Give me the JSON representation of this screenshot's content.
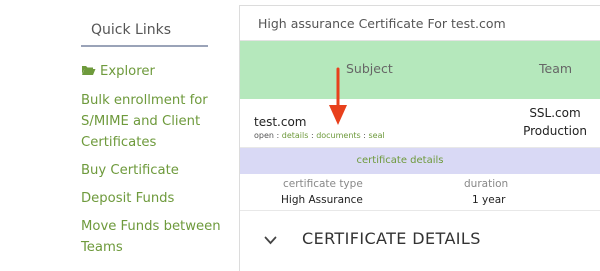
{
  "sidebar": {
    "title": "Quick Links",
    "items": [
      {
        "label": "Explorer",
        "icon": "folder-open-icon"
      },
      {
        "label": "Bulk enrollment for S/MIME and Client Certificates"
      },
      {
        "label": "Buy Certificate"
      },
      {
        "label": "Deposit Funds"
      },
      {
        "label": "Move Funds between Teams"
      }
    ]
  },
  "panel": {
    "title": "High assurance Certificate For test.com",
    "columns": {
      "subject": "Subject",
      "team": "Team"
    },
    "row": {
      "name": "test.com",
      "links_prefix": "open : ",
      "links": [
        "details",
        "documents",
        "seal"
      ],
      "separator": " : ",
      "team_line1": "SSL.com",
      "team_line2": "Production"
    },
    "details_bar": "certificate details",
    "fields": [
      {
        "key": "certificate type",
        "value": "High Assurance"
      },
      {
        "key": "duration",
        "value": "1 year"
      }
    ],
    "section_title": "CERTIFICATE DETAILS"
  },
  "colors": {
    "link_green": "#6e9a3c",
    "header_green": "#b5e8bc",
    "details_lavender": "#d9d9f5",
    "arrow_red": "#e8401c"
  }
}
